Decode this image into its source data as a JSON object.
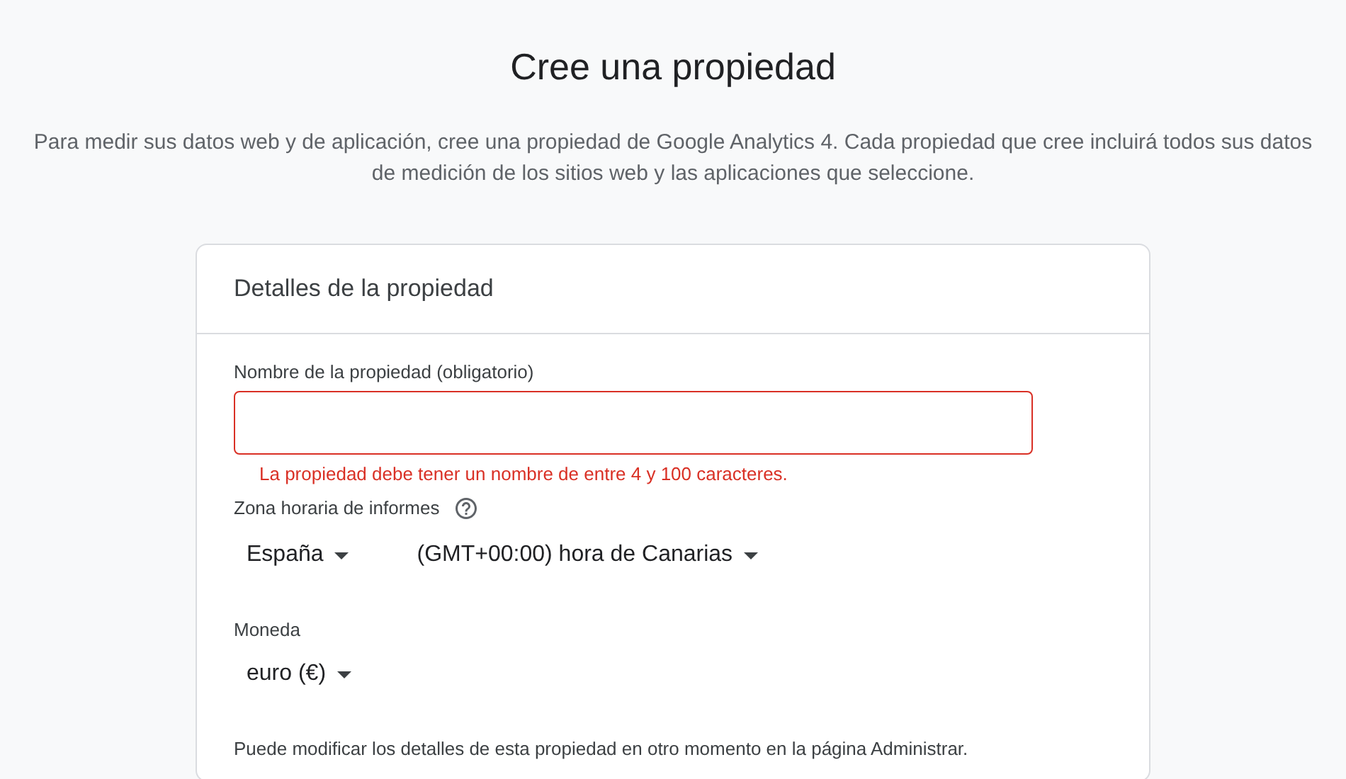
{
  "page_title": "Cree una propiedad",
  "description": "Para medir sus datos web y de aplicación, cree una propiedad de Google Analytics 4. Cada propiedad que cree incluirá todos sus datos de medición de los sitios web y las aplicaciones que seleccione.",
  "card": {
    "title": "Detalles de la propiedad",
    "property_name": {
      "label": "Nombre de la propiedad (obligatorio)",
      "invalid": true,
      "error": "La propiedad debe tener un nombre de entre 4 y 100 caracteres."
    },
    "time_zone": {
      "label": "Zona horaria de informes",
      "dropdowns": [
        {
          "value": "España"
        },
        {
          "value": "(GMT+00:00) hora de Canarias"
        }
      ]
    },
    "currency": {
      "label": "Moneda",
      "dropdowns": [
        {
          "value": "euro (€)"
        }
      ]
    },
    "note": "Puede modificar los detalles de esta propiedad en otro momento en la página Administrar."
  }
}
